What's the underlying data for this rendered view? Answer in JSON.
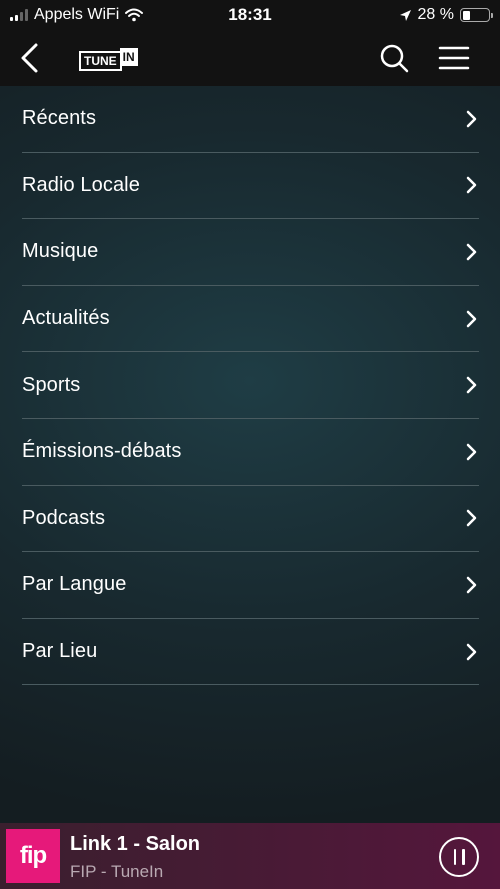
{
  "status_bar": {
    "carrier": "Appels WiFi",
    "time": "18:31",
    "battery": "28 %",
    "battery_level": 0.28,
    "icons": [
      "signal-icon",
      "wifi-icon",
      "location-arrow-icon",
      "battery-icon"
    ]
  },
  "nav": {
    "logo_tune": "TUNE",
    "logo_in": "IN",
    "icons": [
      "back-chevron-icon",
      "search-icon",
      "hamburger-menu-icon"
    ]
  },
  "menu": {
    "items": [
      {
        "label": "Récents"
      },
      {
        "label": "Radio Locale"
      },
      {
        "label": "Musique"
      },
      {
        "label": "Actualités"
      },
      {
        "label": "Sports"
      },
      {
        "label": "Émissions-débats"
      },
      {
        "label": "Podcasts"
      },
      {
        "label": "Par Langue"
      },
      {
        "label": "Par Lieu"
      }
    ],
    "item_icon": "chevron-right-icon"
  },
  "player": {
    "artwork_text": "fip",
    "title": "Link 1 - Salon",
    "subtitle": "FIP - TuneIn",
    "state_icon": "pause-icon"
  },
  "colors": {
    "background": "#18292f",
    "bar": "#121212",
    "divider": "#4a5b60",
    "player_bg": "#4a1a36",
    "artwork_bg": "#e6197a"
  }
}
